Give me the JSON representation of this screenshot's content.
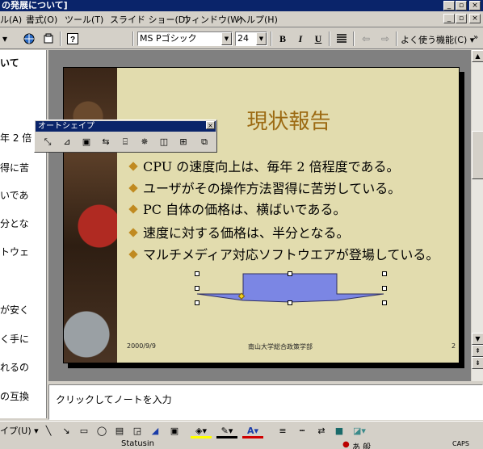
{
  "window": {
    "title": "の発展について]",
    "minimize": "_",
    "restore": "▫",
    "close": "×"
  },
  "menubar": {
    "items": [
      "ル(A)",
      "書式(O)",
      "ツール(T)",
      "スライド ショー(D)",
      "ウィンドウ(W)",
      "ヘルプ(H)"
    ]
  },
  "toolbar": {
    "font_name": "MS Pゴシック",
    "font_size": "24",
    "bold": "B",
    "italic": "I",
    "underline": "U",
    "frequent": "よく使う機能(C)",
    "icons": [
      "globe-icon",
      "insert-icon",
      "help-icon",
      "align-icon",
      "promote-icon",
      "demote-icon"
    ]
  },
  "outline": {
    "lines": [
      "いて",
      "年 2 倍",
      "得に苦",
      "いであ",
      "分とな",
      "トウェ",
      "が安く",
      "く手に",
      "れるの",
      "の互換"
    ]
  },
  "slide": {
    "title": "現状報告",
    "bullets": [
      "CPU の速度向上は、毎年 2 倍程度である。",
      "ユーザがその操作方法習得に苦労している。",
      "PC 自体の価格は、横ばいである。",
      "速度に対する価格は、半分となる。",
      "マルチメディア対応ソフトウエアが登場している。"
    ],
    "footer_date": "2000/9/9",
    "footer_center": "南山大学総合政策学部",
    "footer_page": "2",
    "colors": {
      "background": "#e2dcae",
      "title": "#9c6a12",
      "bullet": "#c08a20",
      "shape_fill": "#7b86e4"
    }
  },
  "autoshape_toolbar": {
    "title": "オートシェイプ",
    "buttons": [
      "shape-tool-1",
      "shape-tool-2",
      "shape-tool-3",
      "shape-tool-4",
      "shape-tool-5",
      "shape-tool-6",
      "shape-tool-7",
      "shape-tool-8",
      "shape-tool-9"
    ]
  },
  "notes": {
    "placeholder": "クリックしてノートを入力"
  },
  "drawbar": {
    "autoshapes_label": "イプ(U) ▾",
    "tools": [
      "line-icon",
      "arrow-icon",
      "rectangle-icon",
      "oval-icon",
      "textbox-icon",
      "wordart-icon",
      "clipart-icon",
      "fill-color-icon",
      "line-color-icon",
      "font-color-icon",
      "line-style-icon",
      "dash-style-icon",
      "arrow-style-icon",
      "shadow-icon",
      "3d-icon"
    ]
  },
  "statusbar": {
    "text": "Statusin",
    "tray": "あ 般 ",
    "caps": "CAPS"
  }
}
